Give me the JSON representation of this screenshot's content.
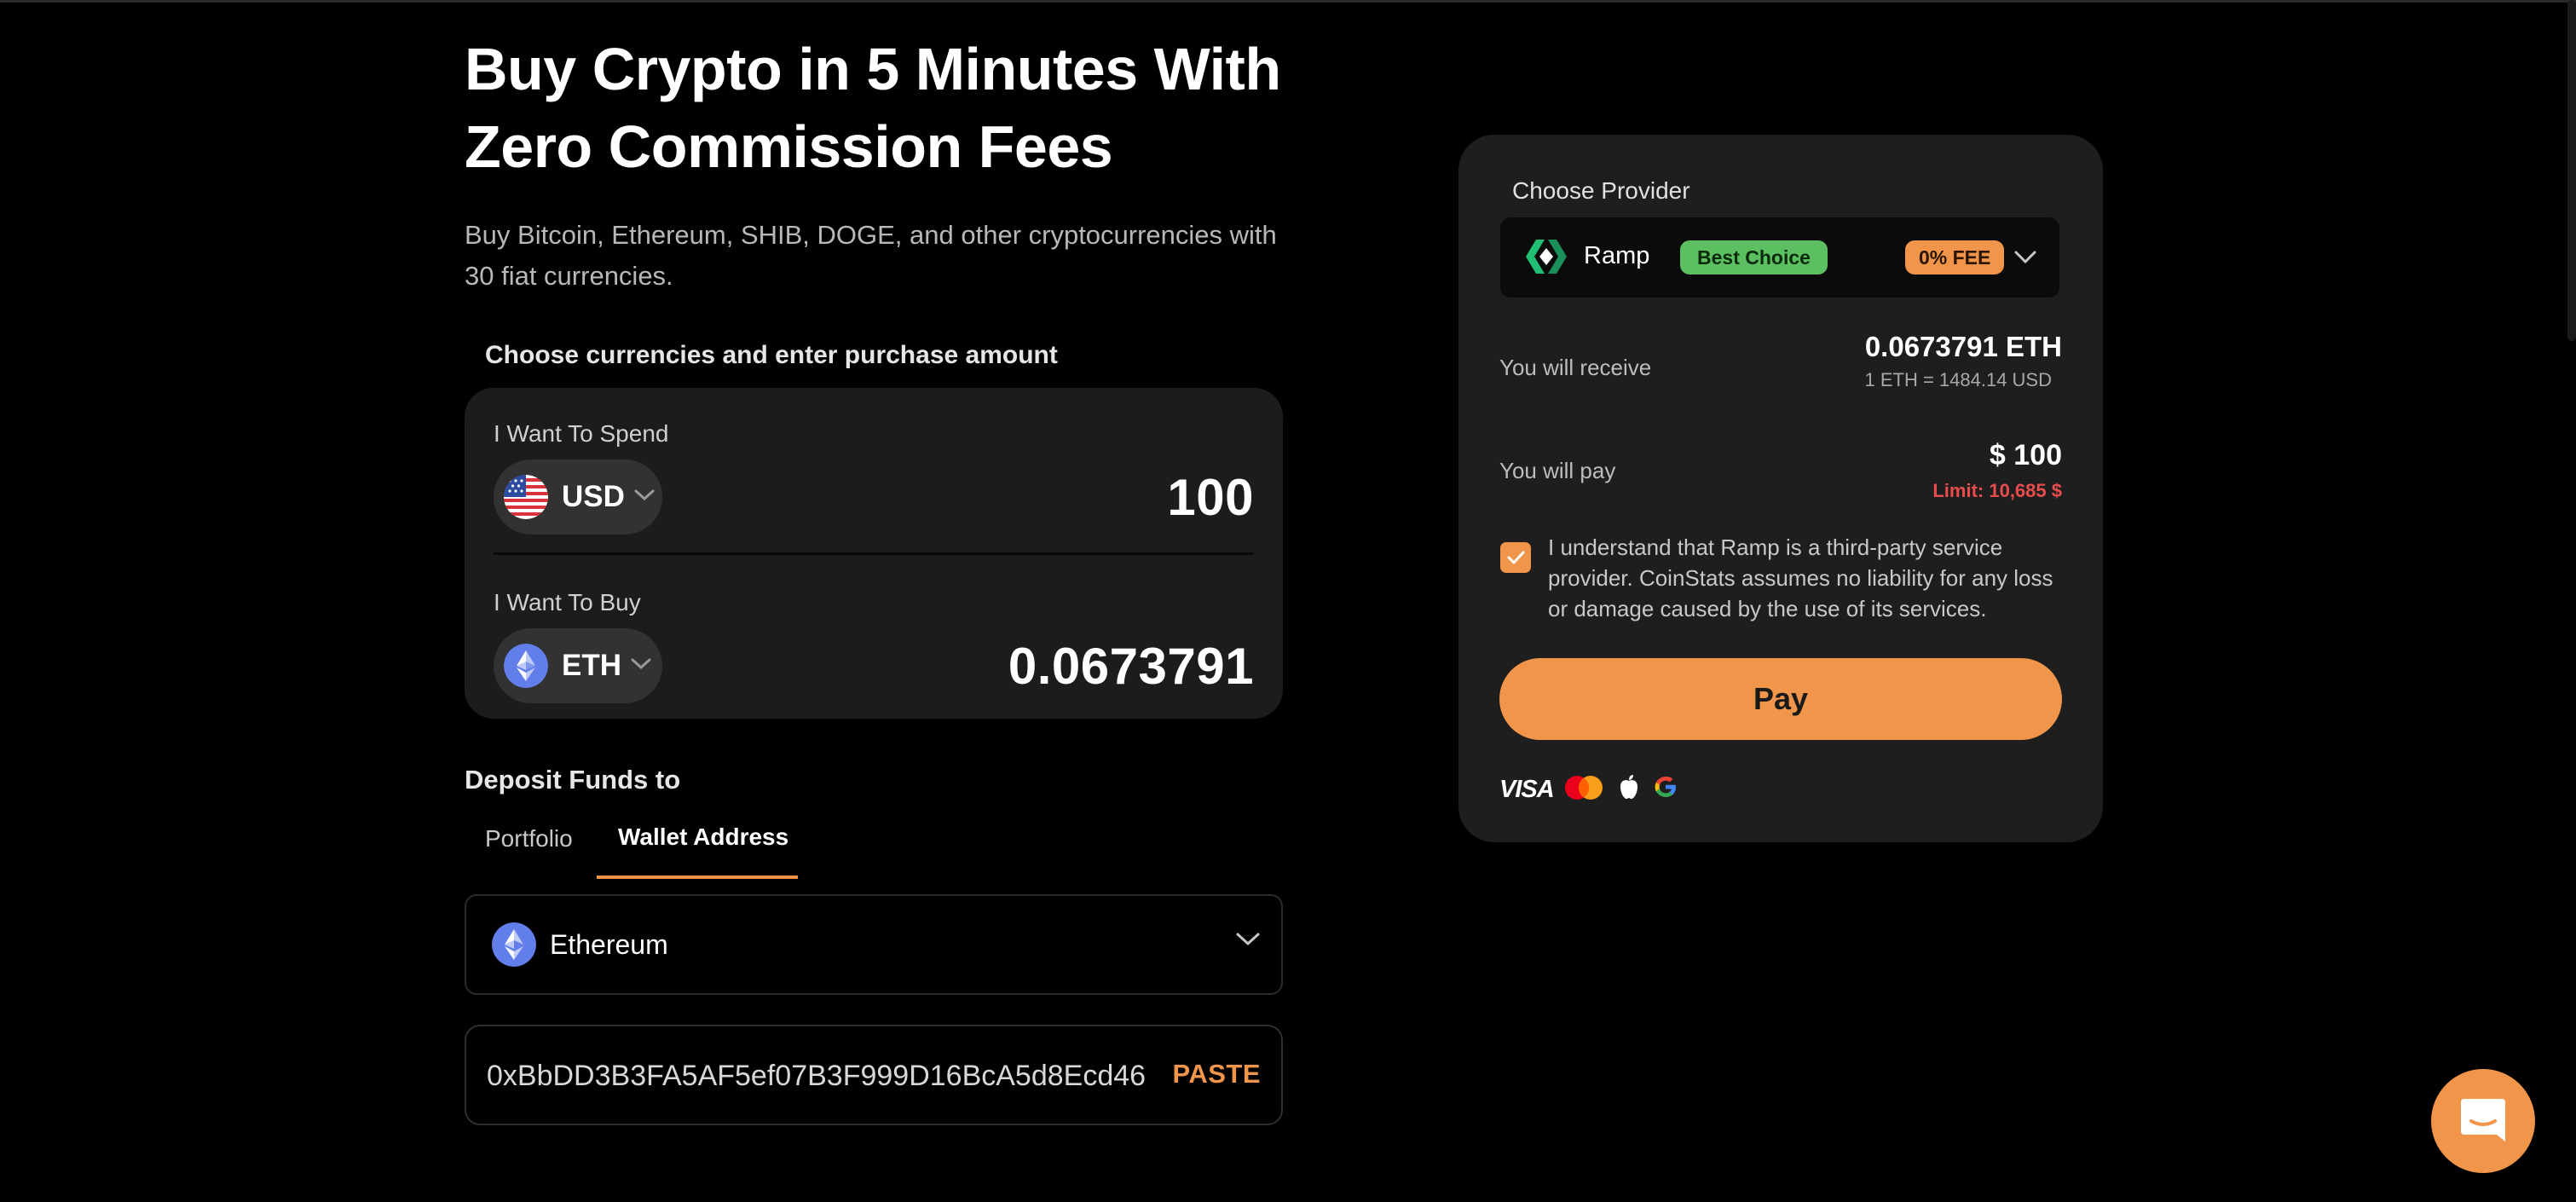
{
  "page": {
    "headline": "Buy Crypto in 5 Minutes With Zero Commission Fees",
    "subtitle": "Buy Bitcoin, Ethereum, SHIB, DOGE, and other cryptocurrencies with 30 fiat currencies."
  },
  "exchange": {
    "heading": "Choose currencies and enter purchase amount",
    "spend": {
      "label": "I Want To Spend",
      "currency": "USD",
      "amount": "100",
      "icon": "us-flag-icon"
    },
    "buy": {
      "label": "I Want To Buy",
      "currency": "ETH",
      "amount": "0.0673791",
      "icon": "ethereum-icon"
    }
  },
  "deposit": {
    "heading": "Deposit Funds to",
    "tabs": [
      "Portfolio",
      "Wallet Address"
    ],
    "active_tab": "Wallet Address",
    "network": "Ethereum",
    "address": "0xBbDD3B3FA5AF5ef07B3F999D16BcA5d8Ecd46",
    "paste_label": "PASTE"
  },
  "provider": {
    "label": "Choose Provider",
    "name": "Ramp",
    "best_badge": "Best Choice",
    "fee_badge": "0% FEE",
    "receive_label": "You will receive",
    "receive_value": "0.0673791 ETH",
    "rate": "1 ETH = 1484.14 USD",
    "pay_label": "You will pay",
    "pay_value": "$ 100",
    "limit": "Limit: 10,685 $",
    "consent_checked": true,
    "consent": "I understand that Ramp is a third-party service provider. CoinStats assumes no liability for any loss or damage caused by the use of its services.",
    "pay_button": "Pay",
    "payment_methods": [
      "visa-icon",
      "mastercard-icon",
      "apple-icon",
      "google-icon"
    ],
    "visa_text": "VISA"
  },
  "colors": {
    "accent": "#f0954a",
    "background": "#000000",
    "card": "#1e1e1e",
    "best_badge": "#5cc062",
    "limit": "#e84c4c"
  }
}
